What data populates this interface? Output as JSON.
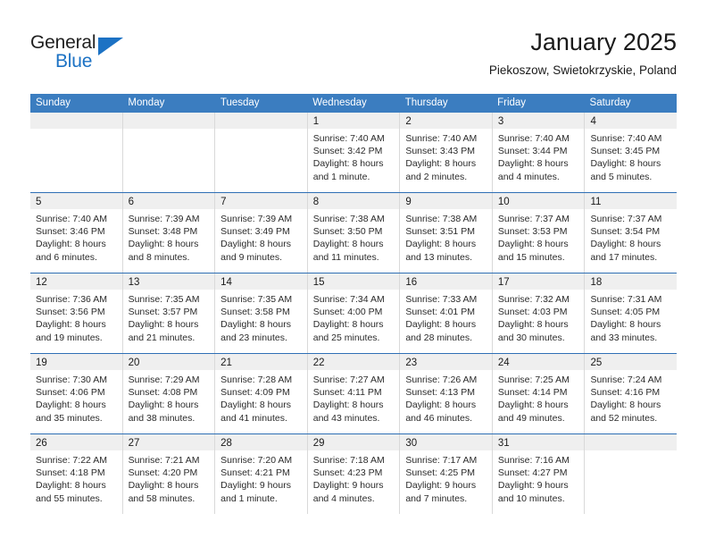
{
  "brand": {
    "name_part1": "General",
    "name_part2": "Blue",
    "triangle_color": "#1c72c4",
    "text_color": "#1f1f1f"
  },
  "header": {
    "title": "January 2025",
    "subtitle": "Piekoszow, Swietokrzyskie, Poland"
  },
  "theme": {
    "header_bar_color": "#3b7dc0",
    "week_divider_color": "#2f6fb5",
    "daynum_band_color": "#efefef",
    "cell_divider_color": "#d9d9d9"
  },
  "weekdays": [
    "Sunday",
    "Monday",
    "Tuesday",
    "Wednesday",
    "Thursday",
    "Friday",
    "Saturday"
  ],
  "weeks": [
    {
      "days": [
        {
          "num": "",
          "sunrise": "",
          "sunset": "",
          "daylight1": "",
          "daylight2": "",
          "empty": true
        },
        {
          "num": "",
          "sunrise": "",
          "sunset": "",
          "daylight1": "",
          "daylight2": "",
          "empty": true
        },
        {
          "num": "",
          "sunrise": "",
          "sunset": "",
          "daylight1": "",
          "daylight2": "",
          "empty": true
        },
        {
          "num": "1",
          "sunrise": "Sunrise: 7:40 AM",
          "sunset": "Sunset: 3:42 PM",
          "daylight1": "Daylight: 8 hours",
          "daylight2": "and 1 minute.",
          "empty": false
        },
        {
          "num": "2",
          "sunrise": "Sunrise: 7:40 AM",
          "sunset": "Sunset: 3:43 PM",
          "daylight1": "Daylight: 8 hours",
          "daylight2": "and 2 minutes.",
          "empty": false
        },
        {
          "num": "3",
          "sunrise": "Sunrise: 7:40 AM",
          "sunset": "Sunset: 3:44 PM",
          "daylight1": "Daylight: 8 hours",
          "daylight2": "and 4 minutes.",
          "empty": false
        },
        {
          "num": "4",
          "sunrise": "Sunrise: 7:40 AM",
          "sunset": "Sunset: 3:45 PM",
          "daylight1": "Daylight: 8 hours",
          "daylight2": "and 5 minutes.",
          "empty": false
        }
      ]
    },
    {
      "days": [
        {
          "num": "5",
          "sunrise": "Sunrise: 7:40 AM",
          "sunset": "Sunset: 3:46 PM",
          "daylight1": "Daylight: 8 hours",
          "daylight2": "and 6 minutes.",
          "empty": false
        },
        {
          "num": "6",
          "sunrise": "Sunrise: 7:39 AM",
          "sunset": "Sunset: 3:48 PM",
          "daylight1": "Daylight: 8 hours",
          "daylight2": "and 8 minutes.",
          "empty": false
        },
        {
          "num": "7",
          "sunrise": "Sunrise: 7:39 AM",
          "sunset": "Sunset: 3:49 PM",
          "daylight1": "Daylight: 8 hours",
          "daylight2": "and 9 minutes.",
          "empty": false
        },
        {
          "num": "8",
          "sunrise": "Sunrise: 7:38 AM",
          "sunset": "Sunset: 3:50 PM",
          "daylight1": "Daylight: 8 hours",
          "daylight2": "and 11 minutes.",
          "empty": false
        },
        {
          "num": "9",
          "sunrise": "Sunrise: 7:38 AM",
          "sunset": "Sunset: 3:51 PM",
          "daylight1": "Daylight: 8 hours",
          "daylight2": "and 13 minutes.",
          "empty": false
        },
        {
          "num": "10",
          "sunrise": "Sunrise: 7:37 AM",
          "sunset": "Sunset: 3:53 PM",
          "daylight1": "Daylight: 8 hours",
          "daylight2": "and 15 minutes.",
          "empty": false
        },
        {
          "num": "11",
          "sunrise": "Sunrise: 7:37 AM",
          "sunset": "Sunset: 3:54 PM",
          "daylight1": "Daylight: 8 hours",
          "daylight2": "and 17 minutes.",
          "empty": false
        }
      ]
    },
    {
      "days": [
        {
          "num": "12",
          "sunrise": "Sunrise: 7:36 AM",
          "sunset": "Sunset: 3:56 PM",
          "daylight1": "Daylight: 8 hours",
          "daylight2": "and 19 minutes.",
          "empty": false
        },
        {
          "num": "13",
          "sunrise": "Sunrise: 7:35 AM",
          "sunset": "Sunset: 3:57 PM",
          "daylight1": "Daylight: 8 hours",
          "daylight2": "and 21 minutes.",
          "empty": false
        },
        {
          "num": "14",
          "sunrise": "Sunrise: 7:35 AM",
          "sunset": "Sunset: 3:58 PM",
          "daylight1": "Daylight: 8 hours",
          "daylight2": "and 23 minutes.",
          "empty": false
        },
        {
          "num": "15",
          "sunrise": "Sunrise: 7:34 AM",
          "sunset": "Sunset: 4:00 PM",
          "daylight1": "Daylight: 8 hours",
          "daylight2": "and 25 minutes.",
          "empty": false
        },
        {
          "num": "16",
          "sunrise": "Sunrise: 7:33 AM",
          "sunset": "Sunset: 4:01 PM",
          "daylight1": "Daylight: 8 hours",
          "daylight2": "and 28 minutes.",
          "empty": false
        },
        {
          "num": "17",
          "sunrise": "Sunrise: 7:32 AM",
          "sunset": "Sunset: 4:03 PM",
          "daylight1": "Daylight: 8 hours",
          "daylight2": "and 30 minutes.",
          "empty": false
        },
        {
          "num": "18",
          "sunrise": "Sunrise: 7:31 AM",
          "sunset": "Sunset: 4:05 PM",
          "daylight1": "Daylight: 8 hours",
          "daylight2": "and 33 minutes.",
          "empty": false
        }
      ]
    },
    {
      "days": [
        {
          "num": "19",
          "sunrise": "Sunrise: 7:30 AM",
          "sunset": "Sunset: 4:06 PM",
          "daylight1": "Daylight: 8 hours",
          "daylight2": "and 35 minutes.",
          "empty": false
        },
        {
          "num": "20",
          "sunrise": "Sunrise: 7:29 AM",
          "sunset": "Sunset: 4:08 PM",
          "daylight1": "Daylight: 8 hours",
          "daylight2": "and 38 minutes.",
          "empty": false
        },
        {
          "num": "21",
          "sunrise": "Sunrise: 7:28 AM",
          "sunset": "Sunset: 4:09 PM",
          "daylight1": "Daylight: 8 hours",
          "daylight2": "and 41 minutes.",
          "empty": false
        },
        {
          "num": "22",
          "sunrise": "Sunrise: 7:27 AM",
          "sunset": "Sunset: 4:11 PM",
          "daylight1": "Daylight: 8 hours",
          "daylight2": "and 43 minutes.",
          "empty": false
        },
        {
          "num": "23",
          "sunrise": "Sunrise: 7:26 AM",
          "sunset": "Sunset: 4:13 PM",
          "daylight1": "Daylight: 8 hours",
          "daylight2": "and 46 minutes.",
          "empty": false
        },
        {
          "num": "24",
          "sunrise": "Sunrise: 7:25 AM",
          "sunset": "Sunset: 4:14 PM",
          "daylight1": "Daylight: 8 hours",
          "daylight2": "and 49 minutes.",
          "empty": false
        },
        {
          "num": "25",
          "sunrise": "Sunrise: 7:24 AM",
          "sunset": "Sunset: 4:16 PM",
          "daylight1": "Daylight: 8 hours",
          "daylight2": "and 52 minutes.",
          "empty": false
        }
      ]
    },
    {
      "days": [
        {
          "num": "26",
          "sunrise": "Sunrise: 7:22 AM",
          "sunset": "Sunset: 4:18 PM",
          "daylight1": "Daylight: 8 hours",
          "daylight2": "and 55 minutes.",
          "empty": false
        },
        {
          "num": "27",
          "sunrise": "Sunrise: 7:21 AM",
          "sunset": "Sunset: 4:20 PM",
          "daylight1": "Daylight: 8 hours",
          "daylight2": "and 58 minutes.",
          "empty": false
        },
        {
          "num": "28",
          "sunrise": "Sunrise: 7:20 AM",
          "sunset": "Sunset: 4:21 PM",
          "daylight1": "Daylight: 9 hours",
          "daylight2": "and 1 minute.",
          "empty": false
        },
        {
          "num": "29",
          "sunrise": "Sunrise: 7:18 AM",
          "sunset": "Sunset: 4:23 PM",
          "daylight1": "Daylight: 9 hours",
          "daylight2": "and 4 minutes.",
          "empty": false
        },
        {
          "num": "30",
          "sunrise": "Sunrise: 7:17 AM",
          "sunset": "Sunset: 4:25 PM",
          "daylight1": "Daylight: 9 hours",
          "daylight2": "and 7 minutes.",
          "empty": false
        },
        {
          "num": "31",
          "sunrise": "Sunrise: 7:16 AM",
          "sunset": "Sunset: 4:27 PM",
          "daylight1": "Daylight: 9 hours",
          "daylight2": "and 10 minutes.",
          "empty": false
        },
        {
          "num": "",
          "sunrise": "",
          "sunset": "",
          "daylight1": "",
          "daylight2": "",
          "empty": true
        }
      ]
    }
  ]
}
